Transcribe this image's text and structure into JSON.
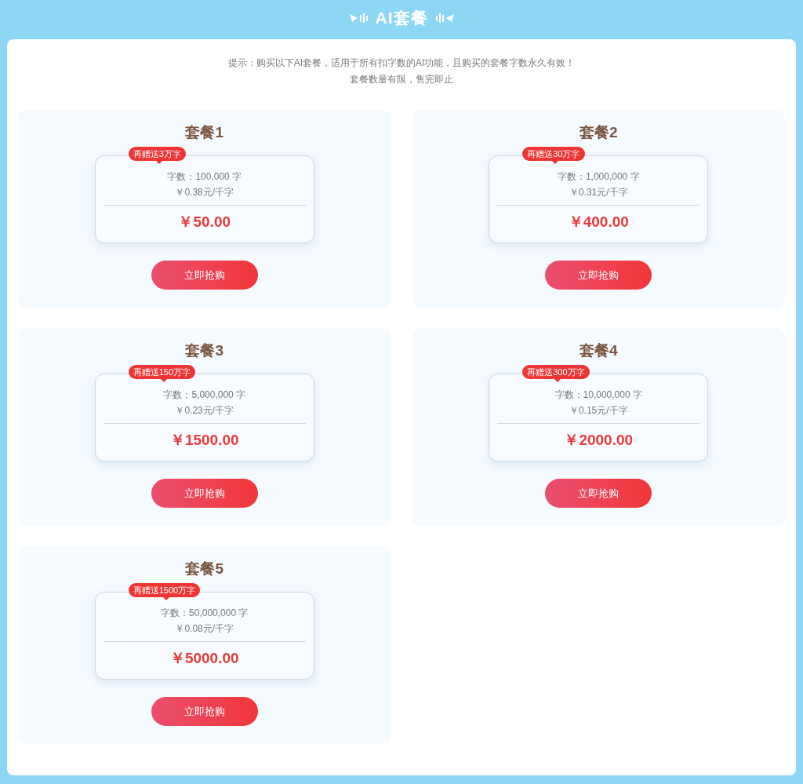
{
  "header": {
    "title": "AI套餐"
  },
  "notice": {
    "lines": [
      "提示：购买以下AI套餐，适用于所有扣字数的AI功能，且购买的套餐字数永久有效！",
      "套餐数量有限，售完即止"
    ]
  },
  "packages": [
    {
      "name": "套餐1",
      "bonus": "再赠送3万字",
      "words": "字数：100,000 字",
      "unit_price": "￥0.38元/千字",
      "price": "￥50.00",
      "button": "立即抢购"
    },
    {
      "name": "套餐2",
      "bonus": "再赠送30万字",
      "words": "字数：1,000,000 字",
      "unit_price": "￥0.31元/千字",
      "price": "￥400.00",
      "button": "立即抢购"
    },
    {
      "name": "套餐3",
      "bonus": "再赠送150万字",
      "words": "字数：5,000,000 字",
      "unit_price": "￥0.23元/千字",
      "price": "￥1500.00",
      "button": "立即抢购"
    },
    {
      "name": "套餐4",
      "bonus": "再赠送300万字",
      "words": "字数：10,000,000 字",
      "unit_price": "￥0.15元/千字",
      "price": "￥2000.00",
      "button": "立即抢购"
    },
    {
      "name": "套餐5",
      "bonus": "再赠送1500万字",
      "words": "字数：50,000,000 字",
      "unit_price": "￥0.08元/千字",
      "price": "￥5000.00",
      "button": "立即抢购"
    }
  ]
}
